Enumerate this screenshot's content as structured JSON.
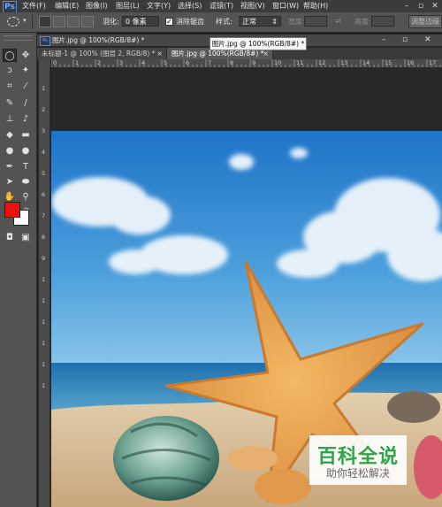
{
  "app": {
    "logo": "Ps"
  },
  "menu": {
    "items": [
      "文件(F)",
      "编辑(E)",
      "图像(I)",
      "图层(L)",
      "文字(Y)",
      "选择(S)",
      "滤镜(T)",
      "视图(V)",
      "窗口(W)",
      "帮助(H)"
    ]
  },
  "options": {
    "feather_label": "羽化:",
    "feather_value": "0 像素",
    "antialias_label": "消除锯齿",
    "antialias_checked": true,
    "style_label": "样式:",
    "style_value": "正常",
    "width_label": "宽度:",
    "height_label": "高度:",
    "refine_edge_label": "调整边缘"
  },
  "toolbar": {
    "fg_color": "#e8110f",
    "bg_color": "#ffffff"
  },
  "tabs": [
    {
      "label": "未标题-1 @ 100% (图层 2, RGB/8) *",
      "active": false
    },
    {
      "label": "图片.jpg @ 100%(RGB/8#) *",
      "active": true
    }
  ],
  "document_title": "图片.jpg @ 100%(RGB/8#) *",
  "tooltip": "图片.jpg @ 100%(RGB/8#) *",
  "rulers": {
    "top": [
      "0",
      "1",
      "2",
      "3",
      "4",
      "5",
      "6",
      "7",
      "8",
      "9",
      "10",
      "11",
      "12",
      "13",
      "14",
      "15",
      "16",
      "17"
    ],
    "left": [
      "1",
      "2",
      "3",
      "4",
      "5",
      "6",
      "7",
      "8",
      "9",
      "1",
      "1",
      "1",
      "1",
      "1",
      "1"
    ]
  },
  "watermark": {
    "title": "百科全说",
    "subtitle": "助你轻松解决"
  }
}
